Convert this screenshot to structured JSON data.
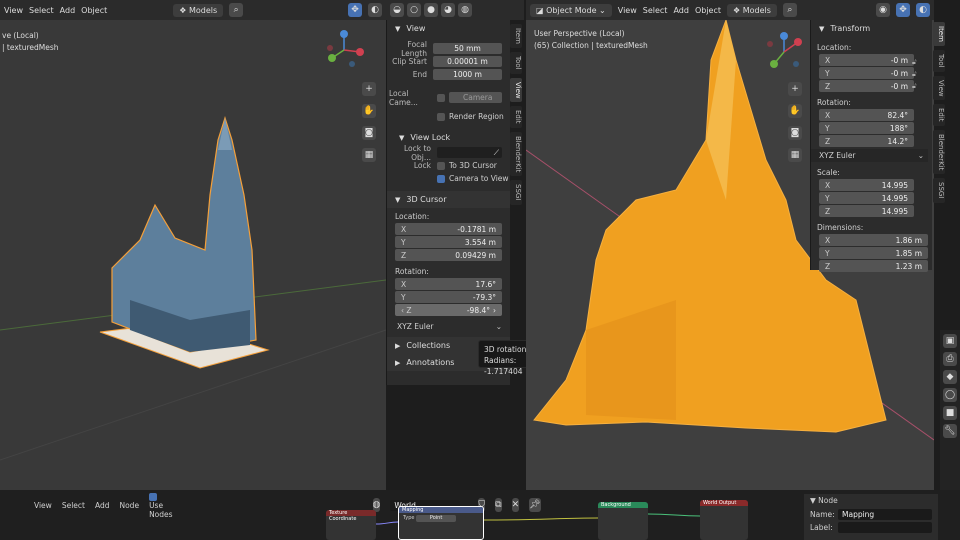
{
  "left_viewport": {
    "header": {
      "view": "View",
      "select": "Select",
      "add": "Add",
      "object": "Object",
      "models": "Models"
    },
    "overlay": {
      "line1": "ve (Local)",
      "line2": "| texturedMesh"
    }
  },
  "sidebar": {
    "view_section": "View",
    "focal_length_label": "Focal Length",
    "focal_length": "50 mm",
    "clip_start_label": "Clip Start",
    "clip_start": "0.00001 m",
    "end_label": "End",
    "end": "1000 m",
    "local_camera_label": "Local Came...",
    "camera": "Camera",
    "render_region": "Render Region",
    "view_lock": "View Lock",
    "lock_to_obj_label": "Lock to Obj...",
    "lock_label": "Lock",
    "to_3d_cursor": "To 3D Cursor",
    "camera_to_view": "Camera to View",
    "cursor_section": "3D Cursor",
    "location_label": "Location:",
    "loc": [
      {
        "k": "X",
        "v": "-0.1781 m"
      },
      {
        "k": "Y",
        "v": "3.554 m"
      },
      {
        "k": "Z",
        "v": "0.09429 m"
      }
    ],
    "rotation_label": "Rotation:",
    "rot": [
      {
        "k": "X",
        "v": "17.6°"
      },
      {
        "k": "Y",
        "v": "-79.3°"
      },
      {
        "k": "Z",
        "v": "-98.4°"
      }
    ],
    "euler": "XYZ Euler",
    "collections": "Collections",
    "annotations": "Annotations",
    "tabs": [
      "Item",
      "Tool",
      "View",
      "Edit",
      "BlenderKit",
      "SSGI"
    ]
  },
  "tooltip": {
    "title": "3D rotation.",
    "radians": "Radians: -1.717404"
  },
  "right_viewport": {
    "header": {
      "mode": "Object Mode",
      "view": "View",
      "select": "Select",
      "add": "Add",
      "object": "Object",
      "models": "Models"
    },
    "overlay": {
      "line1": "User Perspective (Local)",
      "line2": "(65) Collection | texturedMesh"
    }
  },
  "transform": {
    "title": "Transform",
    "location_label": "Location:",
    "loc": [
      {
        "k": "X",
        "v": "-0 m"
      },
      {
        "k": "Y",
        "v": "-0 m"
      },
      {
        "k": "Z",
        "v": "-0 m"
      }
    ],
    "rotation_label": "Rotation:",
    "rot": [
      {
        "k": "X",
        "v": "82.4°"
      },
      {
        "k": "Y",
        "v": "188°"
      },
      {
        "k": "Z",
        "v": "14.2°"
      }
    ],
    "euler": "XYZ Euler",
    "scale_label": "Scale:",
    "scale": [
      {
        "k": "X",
        "v": "14.995"
      },
      {
        "k": "Y",
        "v": "14.995"
      },
      {
        "k": "Z",
        "v": "14.995"
      }
    ],
    "dimensions_label": "Dimensions:",
    "dim": [
      {
        "k": "X",
        "v": "1.86 m"
      },
      {
        "k": "Y",
        "v": "1.85 m"
      },
      {
        "k": "Z",
        "v": "1.23 m"
      }
    ],
    "tabs": [
      "Item",
      "Tool",
      "View",
      "Edit",
      "BlenderKit",
      "SSGI"
    ]
  },
  "node_editor": {
    "view": "View",
    "select": "Select",
    "add": "Add",
    "node": "Node",
    "use_nodes": "Use Nodes",
    "world": "World",
    "node_panel_title": "Node",
    "name_label": "Name:",
    "name_value": "Mapping",
    "label_label": "Label:",
    "nodes": {
      "tex": "Texture Coordinate",
      "mapping": "Mapping",
      "bg": "Background",
      "out": "World Output"
    },
    "mapping_type_label": "Type",
    "mapping_type": "Point"
  },
  "colors": {
    "accent": "#4772b3",
    "mesh": "#f0a020",
    "select_outline": "#f5a03a"
  }
}
